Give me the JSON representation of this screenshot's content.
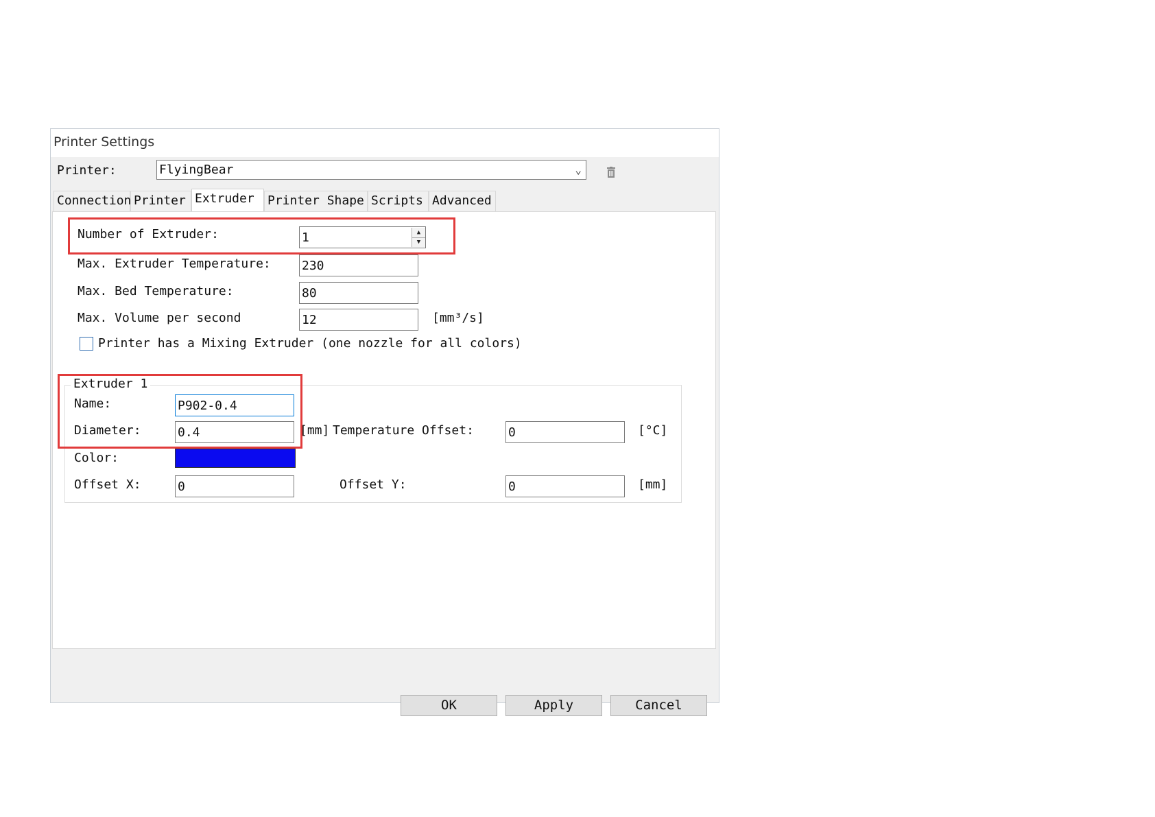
{
  "window": {
    "title": "Printer Settings"
  },
  "printer": {
    "label": "Printer:",
    "selected": "FlyingBear",
    "delete_icon": "trash-icon"
  },
  "tabs": [
    {
      "label": "Connection",
      "active": false
    },
    {
      "label": "Printer",
      "active": false
    },
    {
      "label": "Extruder",
      "active": true
    },
    {
      "label": "Printer Shape",
      "active": false
    },
    {
      "label": "Scripts",
      "active": false
    },
    {
      "label": "Advanced",
      "active": false
    }
  ],
  "extruder": {
    "num_extruders_label": "Number of Extruder:",
    "num_extruders_value": "1",
    "max_extruder_temp_label": "Max. Extruder Temperature:",
    "max_extruder_temp_value": "230",
    "max_bed_temp_label": "Max. Bed Temperature:",
    "max_bed_temp_value": "80",
    "max_volume_label": "Max. Volume per second",
    "max_volume_value": "12",
    "max_volume_unit": "[mm³/s]",
    "mixing_label": "Printer has a Mixing Extruder (one nozzle for all colors)",
    "mixing_checked": false
  },
  "extruder1": {
    "group_title": "Extruder 1",
    "name_label": "Name:",
    "name_value": "P902-0.4",
    "diameter_label": "Diameter:",
    "diameter_value": "0.4",
    "diameter_unit": "[mm]",
    "temp_offset_label": "Temperature Offset:",
    "temp_offset_value": "0",
    "temp_offset_unit": "[°C]",
    "color_label": "Color:",
    "color_value": "#0a0af0",
    "offset_x_label": "Offset X:",
    "offset_x_value": "0",
    "offset_y_label": "Offset Y:",
    "offset_y_value": "0",
    "offset_unit": "[mm]"
  },
  "buttons": {
    "ok": "OK",
    "apply": "Apply",
    "cancel": "Cancel"
  },
  "colors": {
    "highlight": "#e13b3b",
    "focus": "#0078d7"
  }
}
